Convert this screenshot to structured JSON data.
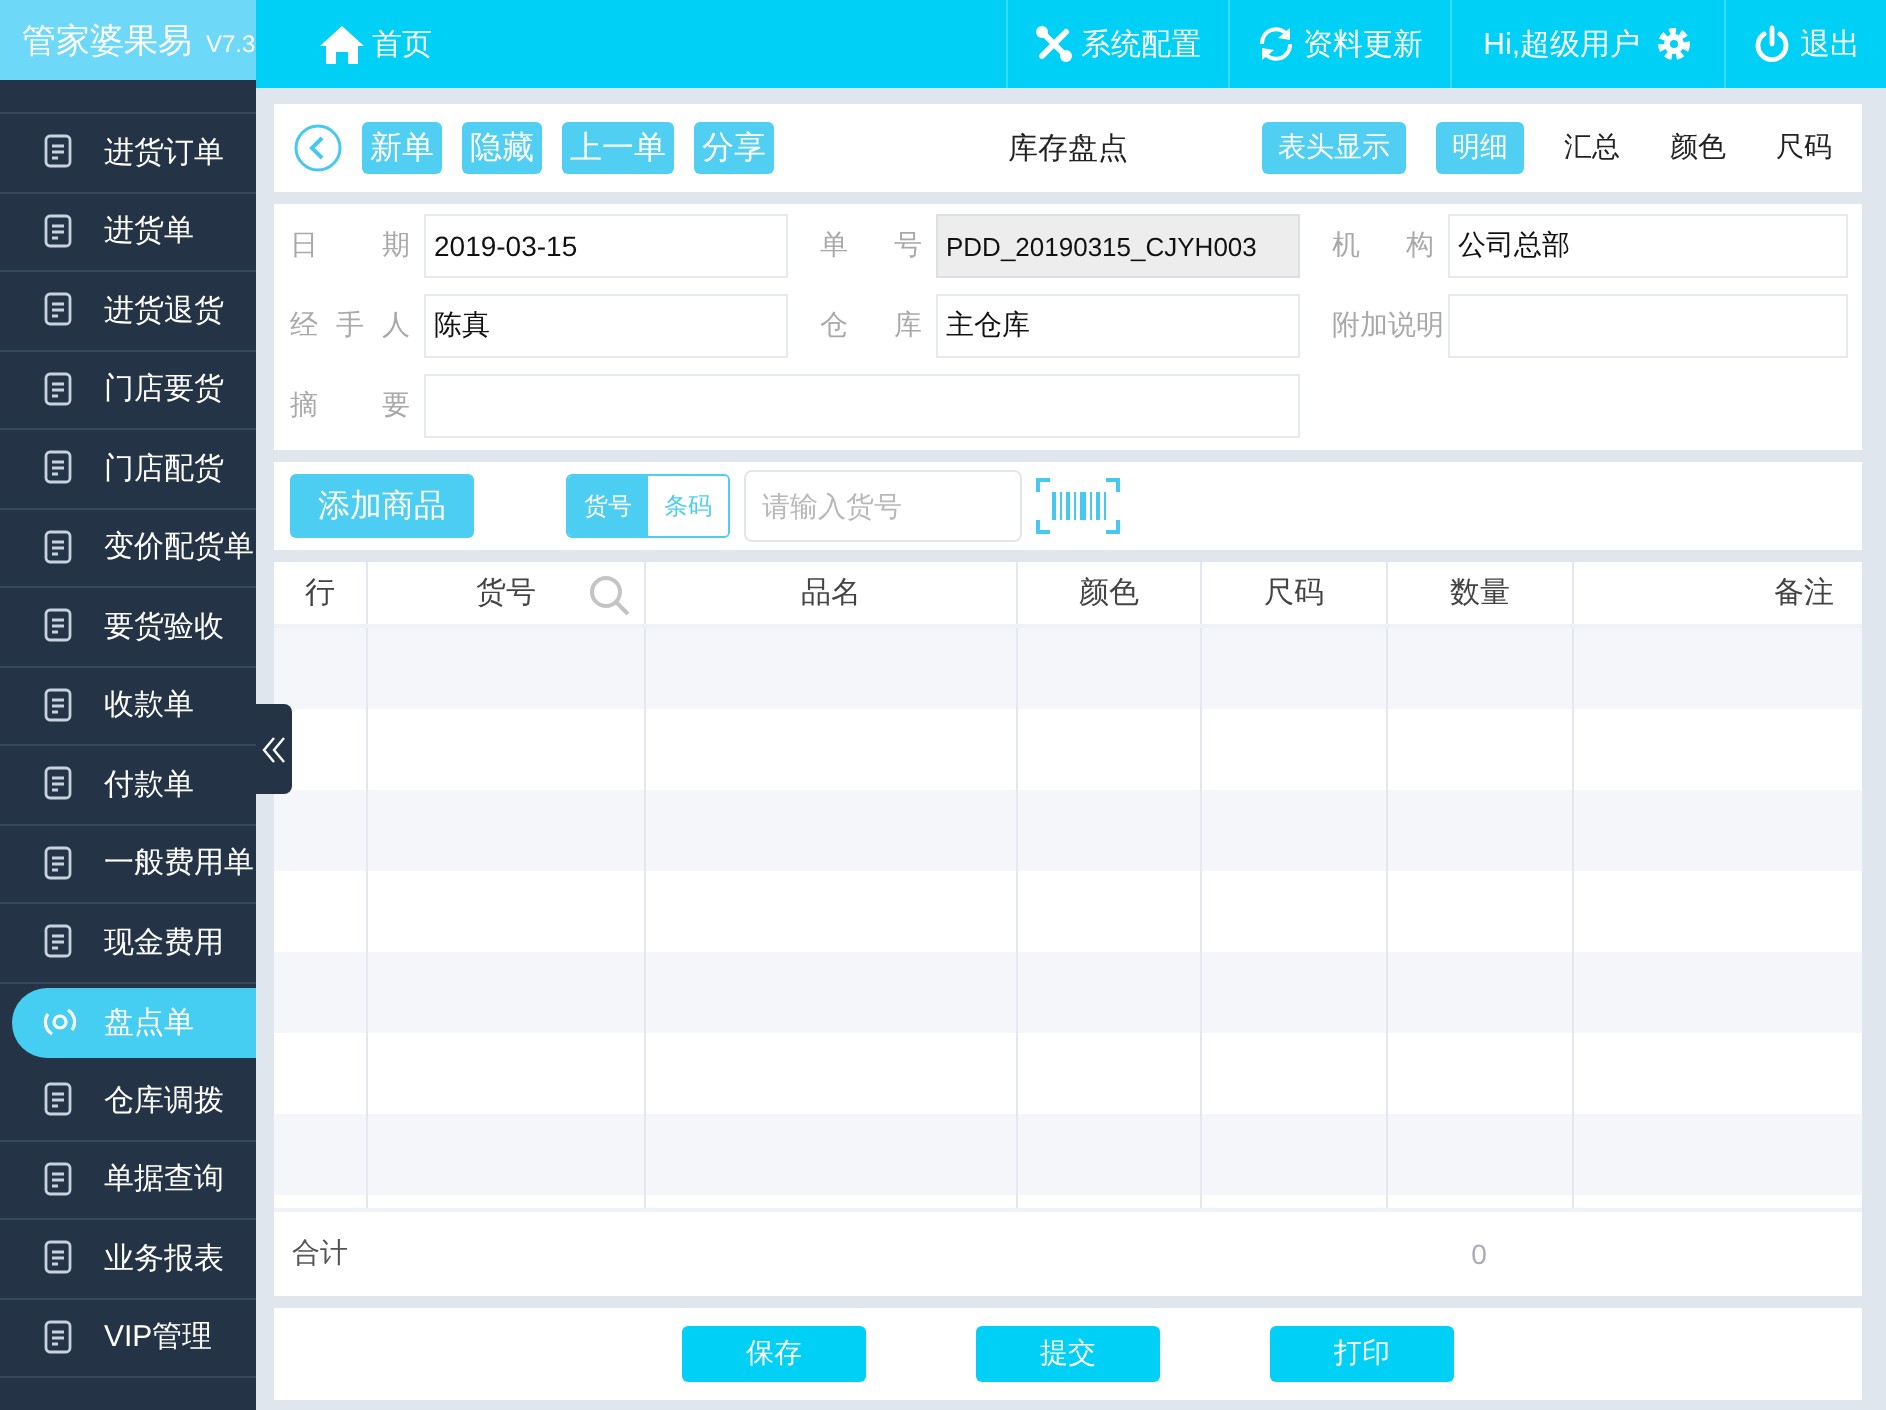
{
  "app": {
    "name": "管家婆果易",
    "version": "V7.3"
  },
  "topbar": {
    "home": "首页",
    "actions": [
      {
        "kind": "settings",
        "label": "系统配置"
      },
      {
        "kind": "refresh",
        "label": "资料更新"
      },
      {
        "kind": "user",
        "label": "Hi,超级用户"
      },
      {
        "kind": "logout",
        "label": "退出"
      }
    ]
  },
  "sidebar": {
    "items": [
      {
        "label": "进货订单",
        "selected": false
      },
      {
        "label": "进货单",
        "selected": false
      },
      {
        "label": "进货退货",
        "selected": false
      },
      {
        "label": "门店要货",
        "selected": false
      },
      {
        "label": "门店配货",
        "selected": false
      },
      {
        "label": "变价配货单",
        "selected": false
      },
      {
        "label": "要货验收",
        "selected": false
      },
      {
        "label": "收款单",
        "selected": false
      },
      {
        "label": "付款单",
        "selected": false
      },
      {
        "label": "一般费用单",
        "selected": false
      },
      {
        "label": "现金费用",
        "selected": false
      },
      {
        "label": "盘点单",
        "selected": true
      },
      {
        "label": "仓库调拨",
        "selected": false
      },
      {
        "label": "单据查询",
        "selected": false
      },
      {
        "label": "业务报表",
        "selected": false
      },
      {
        "label": "VIP管理",
        "selected": false
      }
    ]
  },
  "toolbar": {
    "buttons": [
      "新单",
      "隐藏",
      "上一单",
      "分享"
    ],
    "title": "库存盘点",
    "header_toggle": "表头显示",
    "view_tabs": [
      {
        "label": "明细",
        "selected": true
      },
      {
        "label": "汇总",
        "selected": false
      },
      {
        "label": "颜色",
        "selected": false
      },
      {
        "label": "尺码",
        "selected": false
      }
    ]
  },
  "form": {
    "fields": [
      {
        "label": "日期",
        "value": "2019-03-15",
        "readonly": false
      },
      {
        "label": "单号",
        "value": "PDD_20190315_CJYH003",
        "readonly": true
      },
      {
        "label": "机构",
        "value": "公司总部",
        "readonly": false
      },
      {
        "label": "经手人",
        "value": "陈真",
        "readonly": false
      },
      {
        "label": "仓库",
        "value": "主仓库",
        "readonly": false
      },
      {
        "label": "附加说明",
        "readonly": false
      },
      {
        "label": "摘要",
        "readonly": false,
        "wide": true
      }
    ]
  },
  "add_bar": {
    "add_button": "添加商品",
    "modes": [
      {
        "label": "货号",
        "selected": true
      },
      {
        "label": "条码",
        "selected": false
      }
    ],
    "search": {
      "placeholder": "请输入货号"
    }
  },
  "table": {
    "columns": [
      "行",
      "货号",
      "品名",
      "颜色",
      "尺码",
      "数量",
      "备注"
    ],
    "total": {
      "label": "合计",
      "quantity": "0"
    }
  },
  "footer": {
    "buttons": [
      "保存",
      "提交",
      "打印"
    ]
  }
}
